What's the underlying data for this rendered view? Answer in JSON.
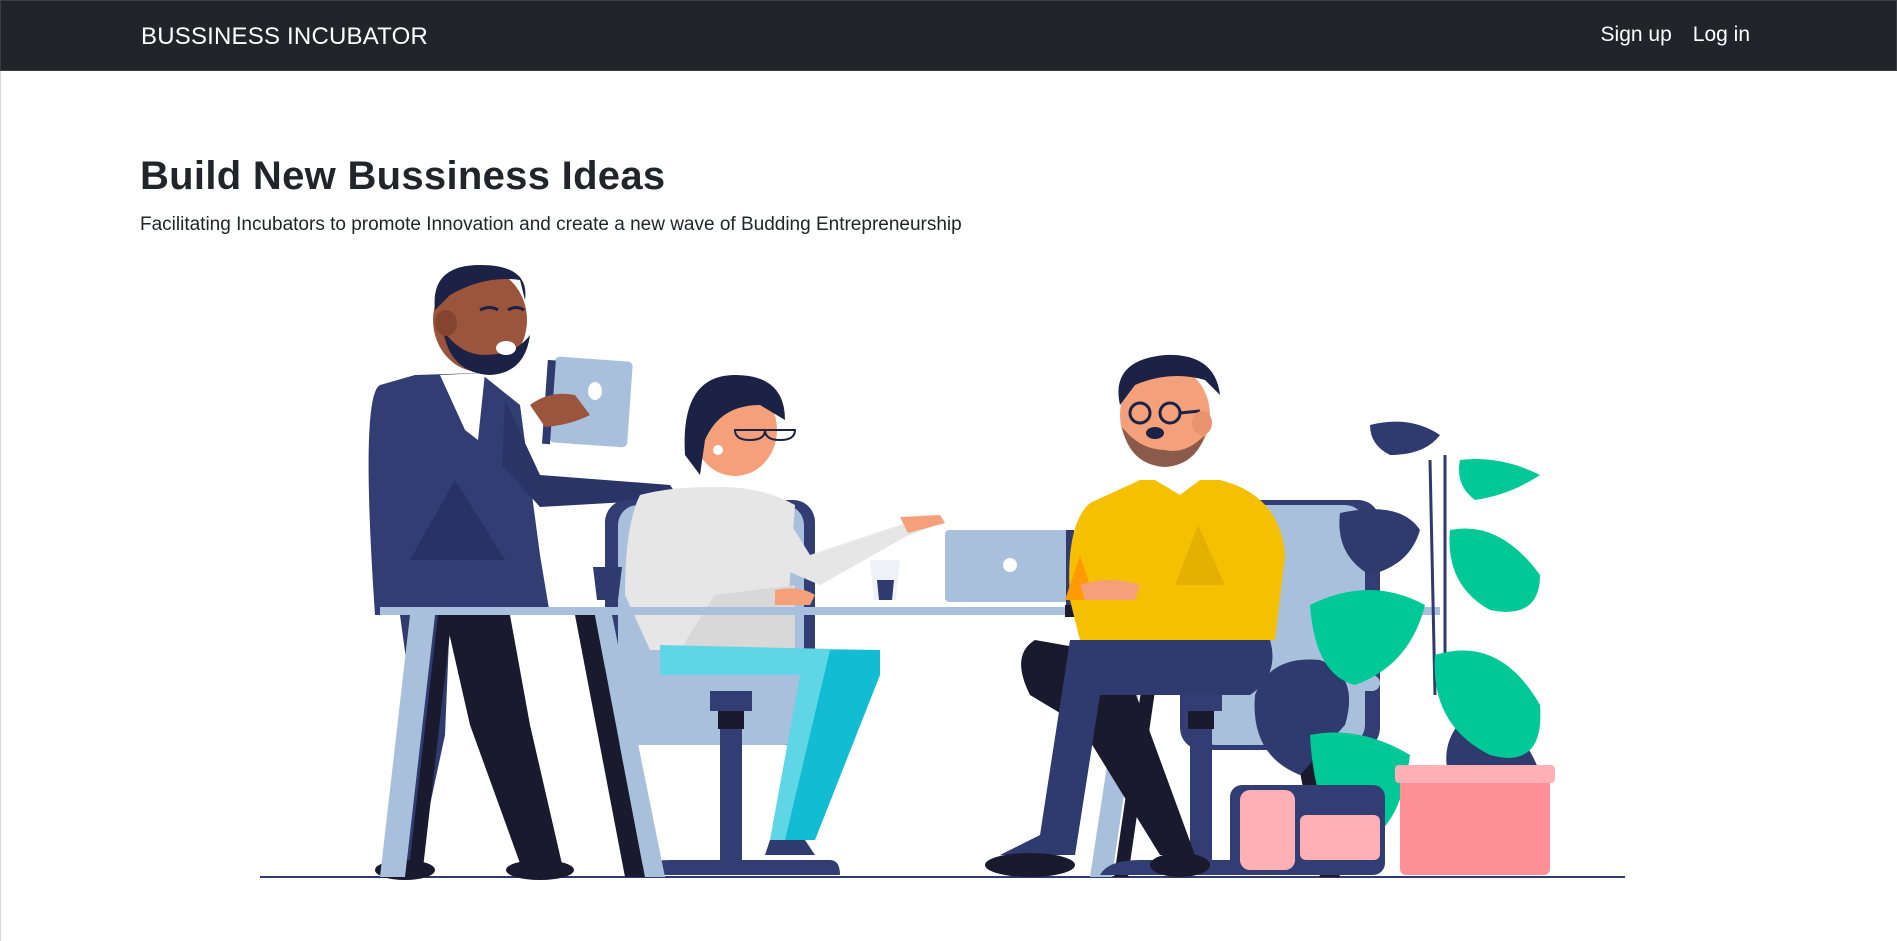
{
  "navbar": {
    "brand": "BUSSINESS INCUBATOR",
    "links": [
      {
        "label": "Sign up"
      },
      {
        "label": "Log in"
      }
    ],
    "background": "#212529"
  },
  "hero": {
    "title": "Build New Bussiness Ideas",
    "subtitle": "Facilitating Incubators to promote Innovation and create a new wave of Budding Entrepreneurship",
    "illustration": "team-meeting-illustration"
  },
  "colors": {
    "navy": "#2f3a6e",
    "dark": "#1a1a2e",
    "light_blue": "#a9c0dc",
    "yellow": "#f5c000",
    "green": "#00c896",
    "pink": "#ff8f96",
    "cyan": "#5fd6e6"
  }
}
